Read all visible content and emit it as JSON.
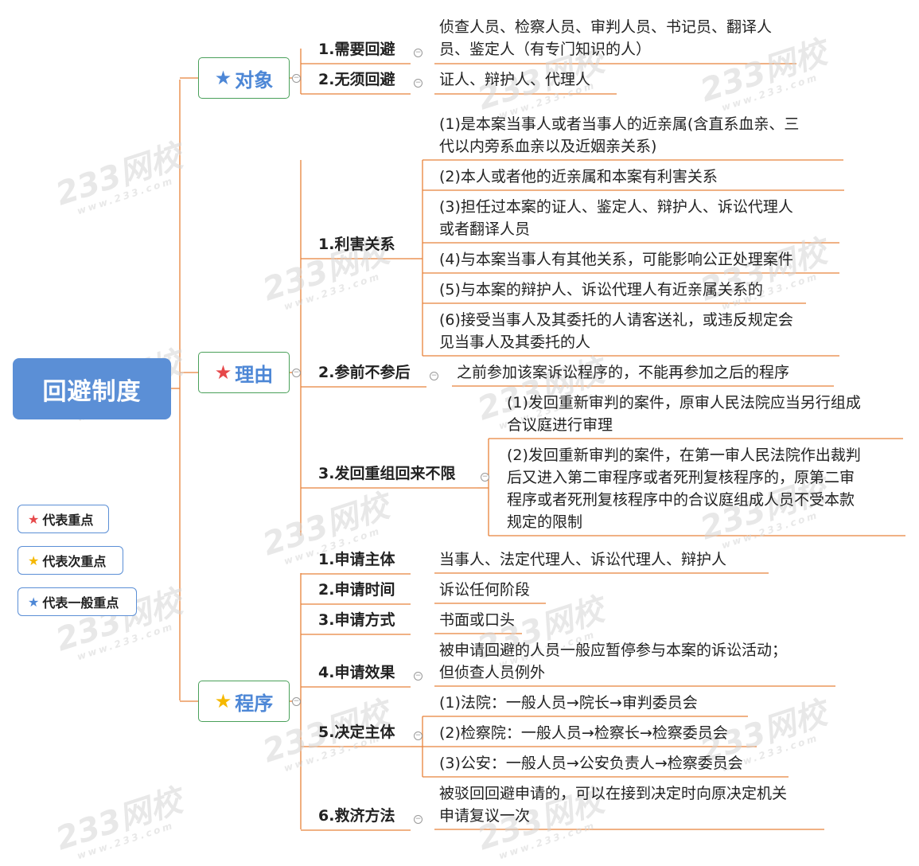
{
  "root": {
    "label": "回避制度"
  },
  "colors": {
    "red_star": "#e6484a",
    "yellow_star": "#f5b800",
    "blue_star": "#4d87d6",
    "line": "#e8823a"
  },
  "categories": [
    {
      "label": "对象",
      "star": "blue",
      "items": [
        {
          "label": "1.需要回避",
          "leaves": [
            "侦查人员、检察人员、审判人员、书记员、翻译人\n员、鉴定人（有专门知识的人）"
          ]
        },
        {
          "label": "2.无须回避",
          "leaves": [
            "证人、辩护人、代理人"
          ]
        }
      ]
    },
    {
      "label": "理由",
      "star": "red",
      "items": [
        {
          "label": "1.利害关系",
          "leaves": [
            "(1)是本案当事人或者当事人的近亲属(含直系血亲、三\n代以内旁系血亲以及近姻亲关系)",
            "(2)本人或者他的近亲属和本案有利害关系",
            "(3)担任过本案的证人、鉴定人、辩护人、诉讼代理人\n或者翻译人员",
            "(4)与本案当事人有其他关系，可能影响公正处理案件",
            "(5)与本案的辩护人、诉讼代理人有近亲属关系的",
            "(6)接受当事人及其委托的人请客送礼，或违反规定会\n见当事人及其委托的人"
          ]
        },
        {
          "label": "2.参前不参后",
          "leaves": [
            "之前参加该案诉讼程序的，不能再参加之后的程序"
          ]
        },
        {
          "label": "3.发回重组回来不限",
          "leaves": [
            "(1)发回重新审判的案件，原审人民法院应当另行组成\n合议庭进行审理",
            "(2)发回重新审判的案件，在第一审人民法院作出裁判\n后又进入第二审程序或者死刑复核程序的，原第二审\n程序或者死刑复核程序中的合议庭组成人员不受本款\n规定的限制"
          ]
        }
      ]
    },
    {
      "label": "程序",
      "star": "yellow",
      "items": [
        {
          "label": "1.申请主体",
          "leaves": [
            "当事人、法定代理人、诉讼代理人、辩护人"
          ]
        },
        {
          "label": "2.申请时间",
          "leaves": [
            "诉讼任何阶段"
          ]
        },
        {
          "label": "3.申请方式",
          "leaves": [
            "书面或口头"
          ]
        },
        {
          "label": "4.申请效果",
          "leaves": [
            "被申请回避的人员一般应暂停参与本案的诉讼活动；\n但侦查人员例外"
          ]
        },
        {
          "label": "5.决定主体",
          "leaves": [
            "(1)法院：一般人员→院长→审判委员会",
            "(2)检察院：一般人员→检察长→检察委员会",
            "(3)公安：一般人员→公安负责人→检察委员会"
          ]
        },
        {
          "label": "6.救济方法",
          "leaves": [
            "被驳回回避申请的，可以在接到决定时向原决定机关\n申请复议一次"
          ]
        }
      ]
    }
  ],
  "legend": [
    {
      "label": "代表重点",
      "star": "red"
    },
    {
      "label": "代表次重点",
      "star": "yellow"
    },
    {
      "label": "代表一般重点",
      "star": "blue"
    }
  ],
  "watermark": {
    "main": "233网校",
    "sub": "www.233.com"
  }
}
